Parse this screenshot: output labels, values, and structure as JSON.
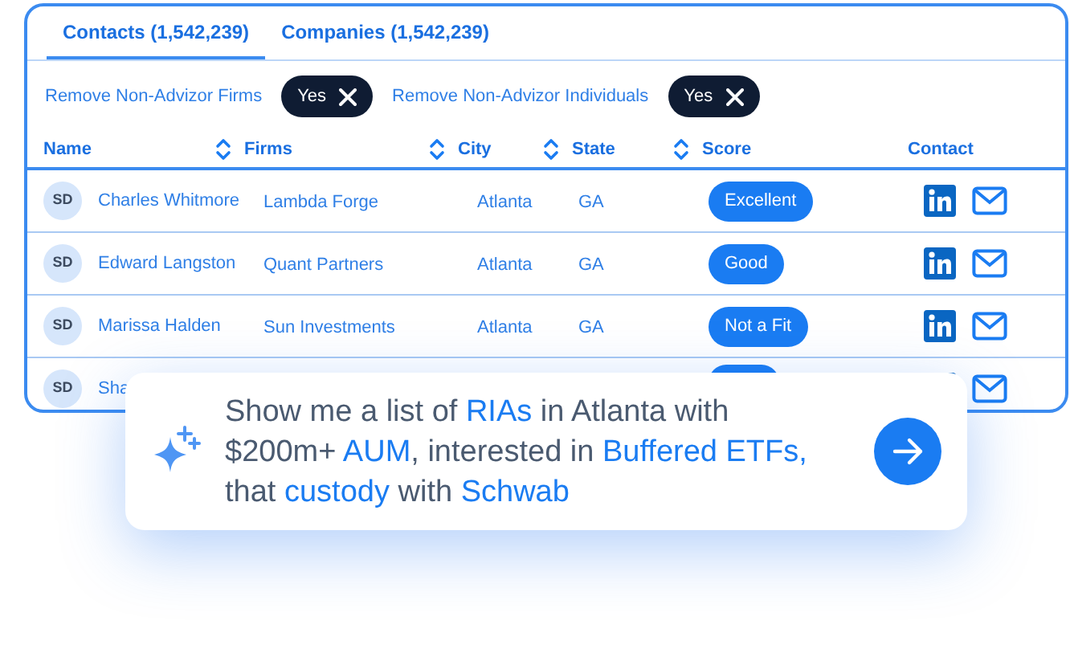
{
  "tabs": [
    {
      "label": "Contacts (1,542,239)",
      "selected": true
    },
    {
      "label": "Companies (1,542,239)",
      "selected": false
    }
  ],
  "filters": [
    {
      "label": "Remove Non-Advizor Firms",
      "value": "Yes"
    },
    {
      "label": "Remove Non-Advizor Individuals",
      "value": "Yes"
    }
  ],
  "table": {
    "columns": [
      {
        "label": "Name",
        "sortable": true
      },
      {
        "label": "Firms",
        "sortable": true
      },
      {
        "label": "City",
        "sortable": true
      },
      {
        "label": "State",
        "sortable": true
      },
      {
        "label": "Score",
        "sortable": false
      },
      {
        "label": "Contact",
        "sortable": false
      }
    ],
    "rows": [
      {
        "initials": "SD",
        "name": "Charles Whitmore",
        "firm": "Lambda Forge",
        "city": "Atlanta",
        "state": "GA",
        "score": "Excellent"
      },
      {
        "initials": "SD",
        "name": "Edward Langston",
        "firm": "Quant Partners",
        "city": "Atlanta",
        "state": "GA",
        "score": "Good"
      },
      {
        "initials": "SD",
        "name": "Marissa Halden",
        "firm": "Sun Investments",
        "city": "Atlanta",
        "state": "GA",
        "score": "Not a Fit"
      },
      {
        "initials": "SD",
        "name": "Sha"
      }
    ]
  },
  "prompt": {
    "segments": [
      {
        "text": "Show me a list of ",
        "highlight": false
      },
      {
        "text": "RIAs",
        "highlight": true
      },
      {
        "text": " in Atlanta with $200m+ ",
        "highlight": false
      },
      {
        "text": "AUM",
        "highlight": true
      },
      {
        "text": ", interested in ",
        "highlight": false
      },
      {
        "text": "Buffered ETFs,",
        "highlight": true
      },
      {
        "text": " that ",
        "highlight": false
      },
      {
        "text": "custody",
        "highlight": true
      },
      {
        "text": " with ",
        "highlight": false
      },
      {
        "text": "Schwab",
        "highlight": true
      }
    ]
  }
}
